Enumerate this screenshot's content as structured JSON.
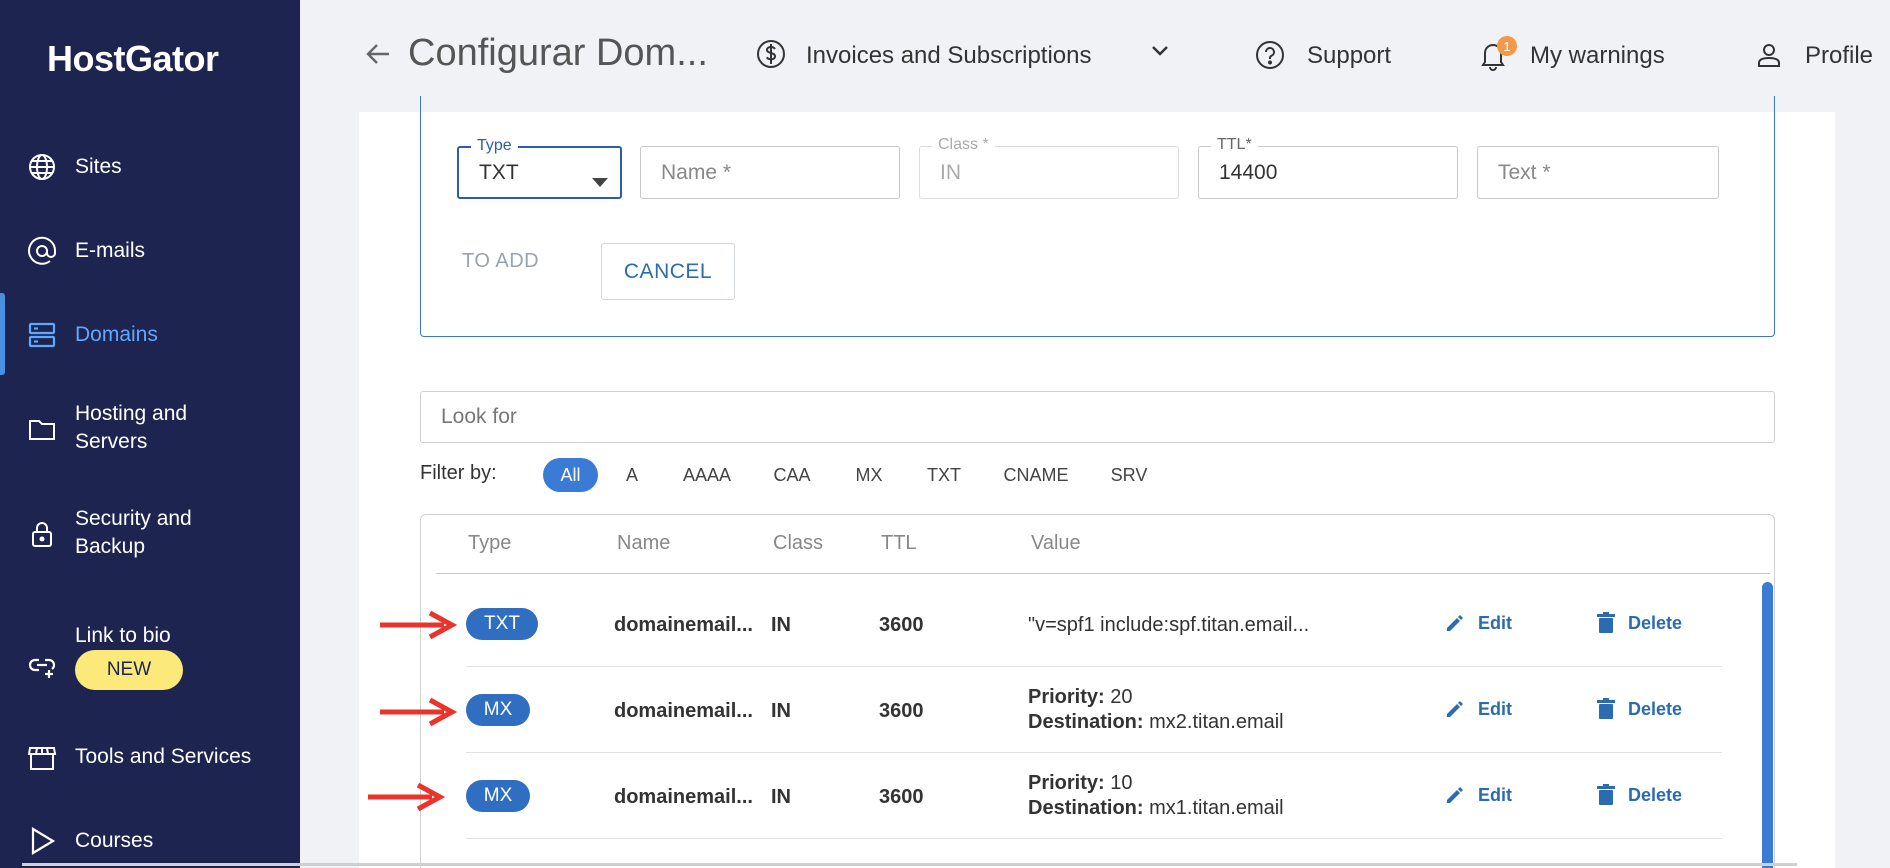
{
  "app": {
    "brand": "HostGator"
  },
  "sidebar": {
    "items": [
      {
        "label": "Sites",
        "icon": "globe-icon"
      },
      {
        "label": "E-mails",
        "icon": "at-icon"
      },
      {
        "label": "Domains",
        "icon": "server-icon",
        "active": true
      },
      {
        "label": "Hosting and Servers",
        "icon": "folder-icon"
      },
      {
        "label": "Security and Backup",
        "icon": "lock-icon"
      },
      {
        "label": "Link to bio",
        "icon": "link-icon",
        "badge": "NEW"
      },
      {
        "label": "Tools and Services",
        "icon": "store-icon"
      },
      {
        "label": "Courses",
        "icon": "play-icon"
      }
    ]
  },
  "header": {
    "title": "Configurar Dom...",
    "invoices": "Invoices and Subscriptions",
    "support": "Support",
    "warnings": "My warnings",
    "warnings_count": "1",
    "profile": "Profile"
  },
  "form": {
    "type_label": "Type",
    "type_value": "TXT",
    "name_placeholder": "Name *",
    "class_label": "Class *",
    "class_value": "IN",
    "ttl_label": "TTL*",
    "ttl_value": "14400",
    "text_placeholder": "Text *",
    "add_label": "TO ADD",
    "cancel_label": "CANCEL"
  },
  "search": {
    "placeholder": "Look for"
  },
  "filter": {
    "label": "Filter by:",
    "options": [
      "All",
      "A",
      "AAAA",
      "CAA",
      "MX",
      "TXT",
      "CNAME",
      "SRV"
    ],
    "selected": "All"
  },
  "table": {
    "columns": [
      "Type",
      "Name",
      "Class",
      "TTL",
      "Value"
    ],
    "rows": [
      {
        "type": "TXT",
        "name": "domainemail...",
        "class": "IN",
        "ttl": "3600",
        "value": "\"v=spf1 include:spf.titan.email...",
        "edit": "Edit",
        "delete": "Delete"
      },
      {
        "type": "MX",
        "name": "domainemail...",
        "class": "IN",
        "ttl": "3600",
        "priority_label": "Priority:",
        "priority": "20",
        "destination_label": "Destination:",
        "destination": "mx2.titan.email",
        "edit": "Edit",
        "delete": "Delete"
      },
      {
        "type": "MX",
        "name": "domainemail...",
        "class": "IN",
        "ttl": "3600",
        "priority_label": "Priority:",
        "priority": "10",
        "destination_label": "Destination:",
        "destination": "mx1.titan.email",
        "edit": "Edit",
        "delete": "Delete"
      }
    ]
  },
  "colors": {
    "sidebar": "#1d2450",
    "accent": "#3a7bd5",
    "annotation_arrow": "#e8342b",
    "badge_new": "#fbe97a"
  }
}
